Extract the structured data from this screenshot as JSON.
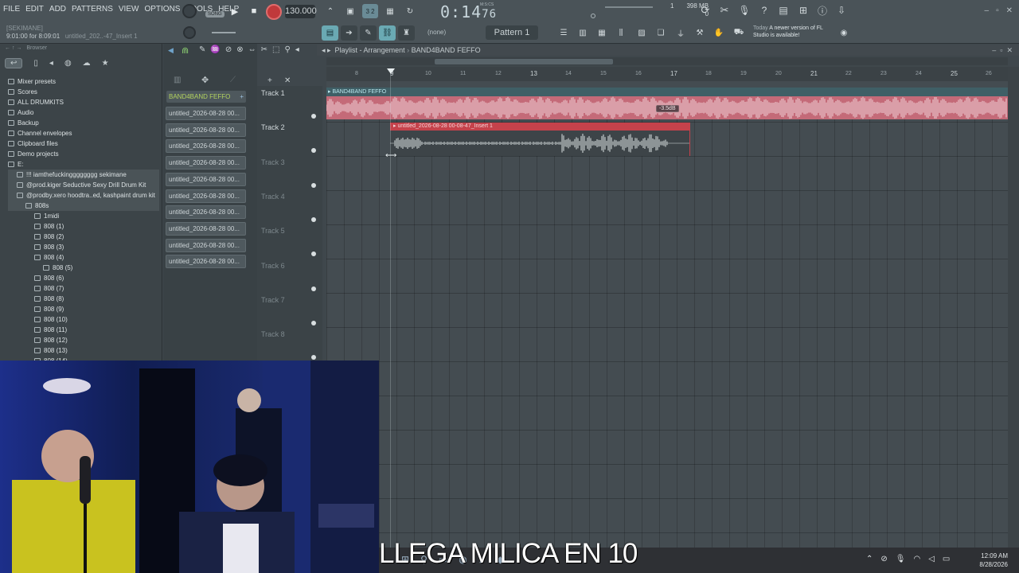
{
  "menu": [
    "FILE",
    "EDIT",
    "ADD",
    "PATTERNS",
    "VIEW",
    "OPTIONS",
    "TOOLS",
    "HELP"
  ],
  "transport": {
    "song_mode": "SONG",
    "tempo": "130.000",
    "time_main": "0:14",
    "time_sub": "76",
    "time_format": "M:S:CS",
    "pattern_number": "3 2"
  },
  "hint": {
    "user": "[SEKIMANE]",
    "position": "9:01:00 for 8:09:01",
    "file": "untitled_202..-47_Insert 1"
  },
  "memory": {
    "value": "398 MB",
    "voices": "0",
    "bar": "1"
  },
  "news": {
    "label": "Today",
    "text": "A newer version of FL Studio is available!"
  },
  "toolbar2": {
    "none_label": "(none)",
    "pattern": "Pattern 1"
  },
  "browser": {
    "title": "Browser",
    "items": [
      {
        "label": "Mixer presets",
        "indent": 0
      },
      {
        "label": "Scores",
        "indent": 0
      },
      {
        "label": "ALL DRUMKITS",
        "indent": 0
      },
      {
        "label": "Audio",
        "indent": 0
      },
      {
        "label": "Backup",
        "indent": 0
      },
      {
        "label": "Channel envelopes",
        "indent": 0
      },
      {
        "label": "Clipboard files",
        "indent": 0
      },
      {
        "label": "Demo projects",
        "indent": 0
      },
      {
        "label": "E:",
        "indent": 0
      },
      {
        "label": "!!! iamthefuckingggggggg sekimane",
        "indent": 1
      },
      {
        "label": "@prod.kiger Seductive Sexy Drill Drum Kit",
        "indent": 1
      },
      {
        "label": "@prodby.xero hoodtra..ed, kashpaint drum kit",
        "indent": 1
      },
      {
        "label": "808s",
        "indent": 2
      },
      {
        "label": "1midi",
        "indent": 3
      },
      {
        "label": "808 (1)",
        "indent": 3
      },
      {
        "label": "808 (2)",
        "indent": 3
      },
      {
        "label": "808 (3)",
        "indent": 3
      },
      {
        "label": "808 (4)",
        "indent": 3
      },
      {
        "label": "808 (5)",
        "indent": 4
      },
      {
        "label": "808 (6)",
        "indent": 3
      },
      {
        "label": "808 (7)",
        "indent": 3
      },
      {
        "label": "808 (8)",
        "indent": 3
      },
      {
        "label": "808 (9)",
        "indent": 3
      },
      {
        "label": "808 (10)",
        "indent": 3
      },
      {
        "label": "808 (11)",
        "indent": 3
      },
      {
        "label": "808 (12)",
        "indent": 3
      },
      {
        "label": "808 (13)",
        "indent": 3
      },
      {
        "label": "808 (14)",
        "indent": 3
      }
    ]
  },
  "picker": {
    "header": "BAND4BAND FEFFO",
    "clips": [
      "untitled_2026-08-28 00...",
      "untitled_2026-08-28 00...",
      "untitled_2026-08-28 00...",
      "untitled_2026-08-28 00...",
      "untitled_2026-08-28 00...",
      "untitled_2026-08-28 00...",
      "untitled_2026-08-28 00...",
      "untitled_2026-08-28 00...",
      "untitled_2026-08-28 00...",
      "untitled_2026-08-28 00..."
    ]
  },
  "playlist": {
    "title": "Playlist - Arrangement",
    "arrangement": "BAND4BAND FEFFO",
    "tracks": [
      "Track 1",
      "Track 2",
      "Track 3",
      "Track 4",
      "Track 5",
      "Track 6",
      "Track 7",
      "Track 8"
    ],
    "ruler": [
      "8",
      "9",
      "10",
      "11",
      "12",
      "13",
      "14",
      "15",
      "16",
      "17",
      "18",
      "19",
      "20",
      "21",
      "22",
      "23",
      "24",
      "25",
      "26"
    ],
    "clip1_label": "BAND4BAND FEFFO",
    "clip2_label": "untitled_2026-08-28 00-08-47_Insert 1",
    "db_tooltip": "-3.5dB"
  },
  "overlay_caption": "LLEGA MILICA EN 10",
  "clock": {
    "time": "12:09 AM",
    "date": "8/28/2026"
  },
  "colors": {
    "accent_green": "#b3d35e",
    "clip_pink": "#c46a78",
    "clip_red": "#c5424b",
    "record": "#c0393b"
  }
}
